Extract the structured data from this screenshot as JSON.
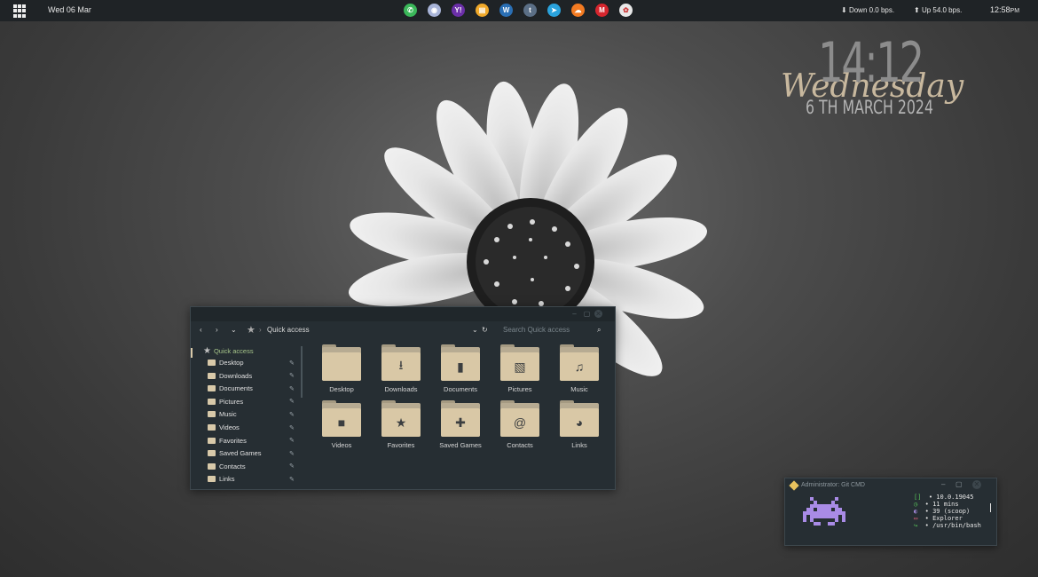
{
  "topbar": {
    "date": "Wed 06 Mar",
    "apps": [
      {
        "icon": "whatsapp-icon",
        "glyph": "✆",
        "color": "#3bb85a"
      },
      {
        "icon": "discord-icon",
        "glyph": "◉",
        "color": "#a8b4d8"
      },
      {
        "icon": "yahoo-icon",
        "glyph": "Y!",
        "color": "#6b2fa8"
      },
      {
        "icon": "notes-icon",
        "glyph": "▤",
        "color": "#f0a92a"
      },
      {
        "icon": "wordpress-icon",
        "glyph": "W",
        "color": "#2a6fb4"
      },
      {
        "icon": "tumblr-icon",
        "glyph": "t",
        "color": "#5b6f86"
      },
      {
        "icon": "telegram-icon",
        "glyph": "➤",
        "color": "#2aa3dd"
      },
      {
        "icon": "soundcloud-icon",
        "glyph": "☁",
        "color": "#f37b22"
      },
      {
        "icon": "gmail-icon",
        "glyph": "M",
        "color": "#d6262e"
      },
      {
        "icon": "photos-icon",
        "glyph": "✿",
        "color": "#e8e8e8"
      }
    ],
    "net_down": "Down 0.0 bps.",
    "net_up": "Up 54.0 bps.",
    "time": "12:58",
    "ampm": "PM"
  },
  "clock": {
    "time": "14:12",
    "day": "Wednesday",
    "date": "6 TH MARCH 2024"
  },
  "explorer": {
    "location": "Quick access",
    "search_placeholder": "Search Quick access",
    "sidebar_header": "Quick access",
    "sidebar": [
      "Desktop",
      "Downloads",
      "Documents",
      "Pictures",
      "Music",
      "Videos",
      "Favorites",
      "Saved Games",
      "Contacts",
      "Links"
    ],
    "folders": [
      {
        "label": "Desktop",
        "glyph": ""
      },
      {
        "label": "Downloads",
        "glyph": "⭳"
      },
      {
        "label": "Documents",
        "glyph": "▮"
      },
      {
        "label": "Pictures",
        "glyph": "▧"
      },
      {
        "label": "Music",
        "glyph": "♫"
      },
      {
        "label": "Videos",
        "glyph": "■"
      },
      {
        "label": "Favorites",
        "glyph": "★"
      },
      {
        "label": "Saved Games",
        "glyph": "✚"
      },
      {
        "label": "Contacts",
        "glyph": "@"
      },
      {
        "label": "Links",
        "glyph": "◕"
      }
    ]
  },
  "terminal": {
    "title": "Administrator: Git CMD",
    "lines": [
      {
        "icon": "[]",
        "color": "#58c35a",
        "text": "• 10.0.19045"
      },
      {
        "icon": "◷",
        "color": "#58c35a",
        "text": "• 11 mins"
      },
      {
        "icon": "◐",
        "color": "#a78be0",
        "text": "• 39 (scoop)"
      },
      {
        "icon": "▭",
        "color": "#e0607a",
        "text": "• Explorer"
      },
      {
        "icon": "↪",
        "color": "#58c35a",
        "text": "• /usr/bin/bash"
      }
    ]
  }
}
